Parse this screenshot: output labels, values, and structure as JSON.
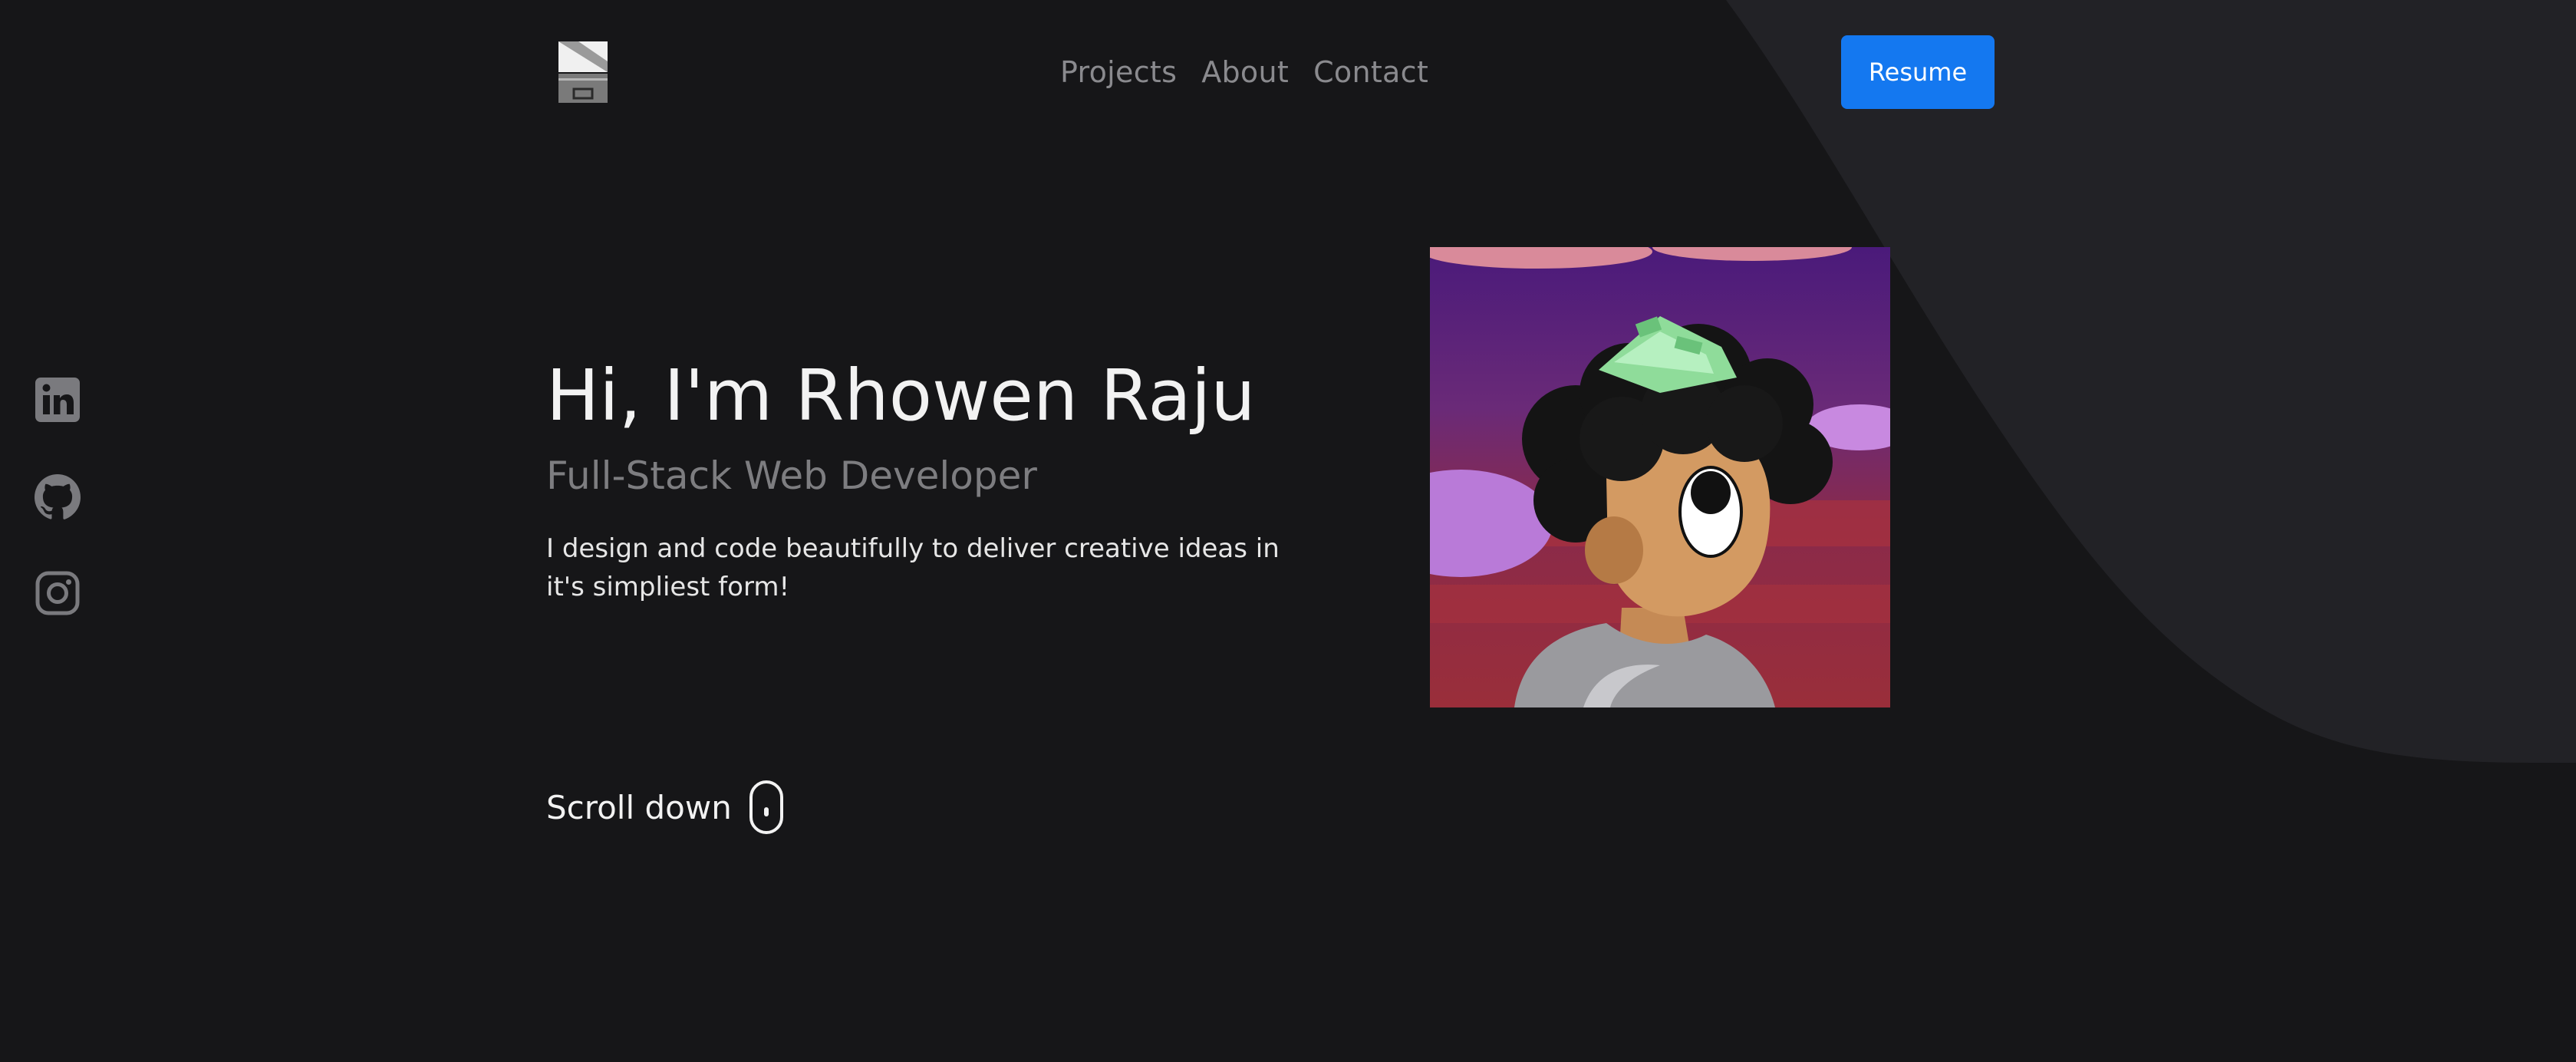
{
  "nav": {
    "items": [
      {
        "label": "Projects"
      },
      {
        "label": "About"
      },
      {
        "label": "Contact"
      }
    ],
    "resume_label": "Resume"
  },
  "social": {
    "items": [
      {
        "icon": "linkedin-icon"
      },
      {
        "icon": "github-icon"
      },
      {
        "icon": "instagram-icon"
      }
    ]
  },
  "hero": {
    "title": "Hi, I'm Rhowen Raju",
    "subtitle": "Full-Stack Web Developer",
    "description": "I design and code beautifully to deliver creative ideas in it's simpliest form!",
    "scroll_label": "Scroll down"
  },
  "colors": {
    "background": "#161618",
    "accent_shape": "#222226",
    "button": "#1478f0",
    "nav_text": "#8a8a8e"
  }
}
